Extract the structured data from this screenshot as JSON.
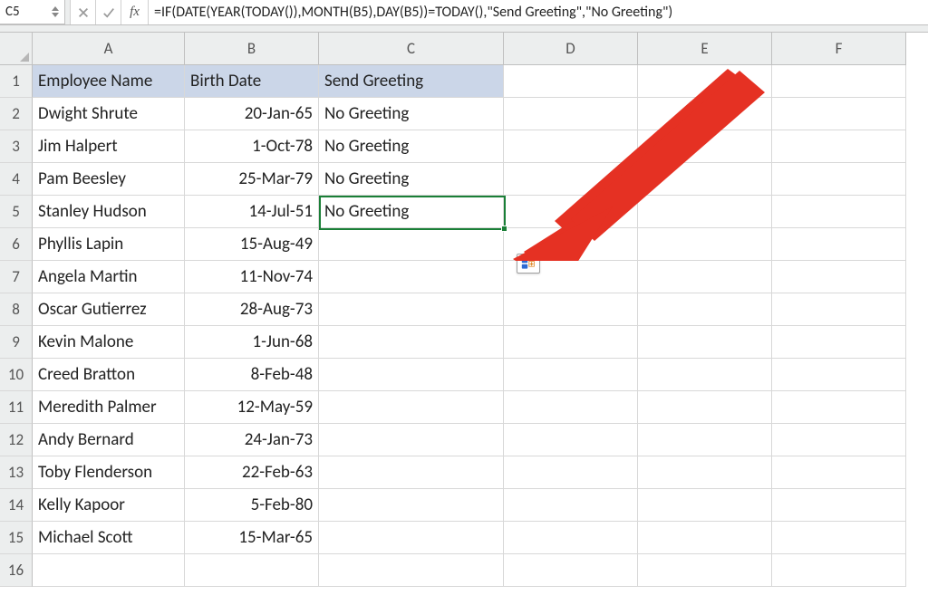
{
  "name_box": "C5",
  "formula": "=IF(DATE(YEAR(TODAY()),MONTH(B5),DAY(B5))=TODAY(),\"Send Greeting\",\"No Greeting\")",
  "fx_label": "fx",
  "columns": [
    "A",
    "B",
    "C",
    "D",
    "E",
    "F"
  ],
  "row_numbers": [
    "1",
    "2",
    "3",
    "4",
    "5",
    "6",
    "7",
    "8",
    "9",
    "10",
    "11",
    "12",
    "13",
    "14",
    "15",
    "16"
  ],
  "headers": {
    "A": "Employee Name",
    "B": "Birth Date",
    "C": "Send Greeting"
  },
  "rows": [
    {
      "name": "Dwight Shrute",
      "date": "20-Jan-65",
      "greet": "No Greeting"
    },
    {
      "name": "Jim Halpert",
      "date": "1-Oct-78",
      "greet": "No Greeting"
    },
    {
      "name": "Pam Beesley",
      "date": "25-Mar-79",
      "greet": "No Greeting"
    },
    {
      "name": "Stanley Hudson",
      "date": "14-Jul-51",
      "greet": "No Greeting"
    },
    {
      "name": "Phyllis Lapin",
      "date": "15-Aug-49",
      "greet": ""
    },
    {
      "name": "Angela Martin",
      "date": "11-Nov-74",
      "greet": ""
    },
    {
      "name": "Oscar Gutierrez",
      "date": "28-Aug-73",
      "greet": ""
    },
    {
      "name": "Kevin Malone",
      "date": "1-Jun-68",
      "greet": ""
    },
    {
      "name": "Creed Bratton",
      "date": "8-Feb-48",
      "greet": ""
    },
    {
      "name": "Meredith Palmer",
      "date": "12-May-59",
      "greet": ""
    },
    {
      "name": "Andy Bernard",
      "date": "24-Jan-73",
      "greet": ""
    },
    {
      "name": "Toby Flenderson",
      "date": "22-Feb-63",
      "greet": ""
    },
    {
      "name": "Kelly Kapoor",
      "date": "5-Feb-80",
      "greet": ""
    },
    {
      "name": "Michael Scott",
      "date": "15-Mar-65",
      "greet": ""
    }
  ],
  "active_cell": "C5",
  "selection": {
    "row": 5,
    "col": "C"
  },
  "arrow_color": "#e53123"
}
